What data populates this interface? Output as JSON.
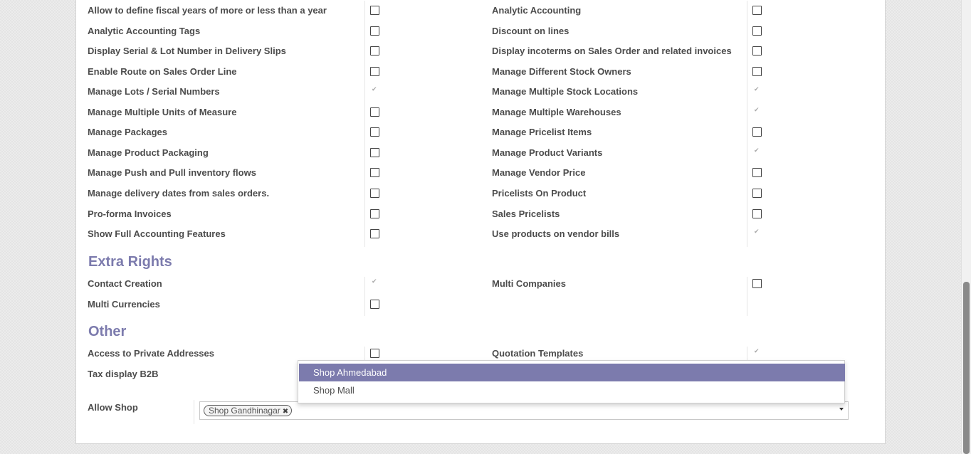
{
  "technical_settings": {
    "left_column": [
      {
        "label": "Allow to define fiscal years of more or less than a year",
        "checked": false
      },
      {
        "label": "Analytic Accounting Tags",
        "checked": false
      },
      {
        "label": "Display Serial & Lot Number in Delivery Slips",
        "checked": false
      },
      {
        "label": "Enable Route on Sales Order Line",
        "checked": false
      },
      {
        "label": "Manage Lots / Serial Numbers",
        "checked": true
      },
      {
        "label": "Manage Multiple Units of Measure",
        "checked": false
      },
      {
        "label": "Manage Packages",
        "checked": false
      },
      {
        "label": "Manage Product Packaging",
        "checked": false
      },
      {
        "label": "Manage Push and Pull inventory flows",
        "checked": false
      },
      {
        "label": "Manage delivery dates from sales orders.",
        "checked": false
      },
      {
        "label": "Pro-forma Invoices",
        "checked": false
      },
      {
        "label": "Show Full Accounting Features",
        "checked": false
      }
    ],
    "right_column": [
      {
        "label": "Analytic Accounting",
        "checked": false
      },
      {
        "label": "Discount on lines",
        "checked": false
      },
      {
        "label": "Display incoterms on Sales Order and related invoices",
        "checked": false
      },
      {
        "label": "Manage Different Stock Owners",
        "checked": false
      },
      {
        "label": "Manage Multiple Stock Locations",
        "checked": true
      },
      {
        "label": "Manage Multiple Warehouses",
        "checked": true
      },
      {
        "label": "Manage Pricelist Items",
        "checked": false
      },
      {
        "label": "Manage Product Variants",
        "checked": true
      },
      {
        "label": "Manage Vendor Price",
        "checked": false
      },
      {
        "label": "Pricelists On Product",
        "checked": false
      },
      {
        "label": "Sales Pricelists",
        "checked": false
      },
      {
        "label": "Use products on vendor bills",
        "checked": true
      }
    ]
  },
  "extra_rights": {
    "title": "Extra Rights",
    "left_column": [
      {
        "label": "Contact Creation",
        "checked": true
      },
      {
        "label": "Multi Currencies",
        "checked": false
      }
    ],
    "right_column": [
      {
        "label": "Multi Companies",
        "checked": false
      }
    ]
  },
  "other": {
    "title": "Other",
    "left_column": [
      {
        "label": "Access to Private Addresses",
        "checked": false
      },
      {
        "label": "Tax display B2B",
        "checked": false
      }
    ],
    "right_column": [
      {
        "label": "Quotation Templates",
        "checked": true
      }
    ]
  },
  "allow_shop": {
    "label": "Allow Shop",
    "tags": [
      "Shop Gandhinagar"
    ],
    "dropdown_options": [
      "Shop Ahmedabad",
      "Shop Mall"
    ],
    "highlighted_option": "Shop Ahmedabad"
  },
  "colors": {
    "accent": "#7c7bad",
    "label_text": "#4c4c4c"
  }
}
